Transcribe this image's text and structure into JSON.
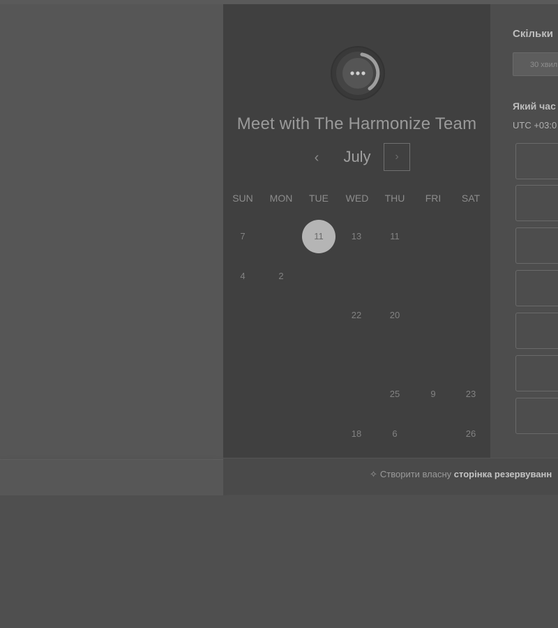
{
  "calendar": {
    "title": "Meet with The Harmonize Team",
    "month": "July",
    "prev_label": "‹",
    "next_label": "›",
    "weekdays": [
      "SUN",
      "MON",
      "TUE",
      "WED",
      "THU",
      "FRI",
      "SAT"
    ],
    "selected_day": "11",
    "days": [
      {
        "label": "7",
        "col": 0,
        "row": 0
      },
      {
        "label": "11",
        "col": 2,
        "row": 0,
        "selected": true
      },
      {
        "label": "13",
        "col": 3,
        "row": 0
      },
      {
        "label": "11",
        "col": 4,
        "row": 0
      },
      {
        "label": "4",
        "col": 0,
        "row": 1
      },
      {
        "label": "2",
        "col": 1,
        "row": 1
      },
      {
        "label": "22",
        "col": 3,
        "row": 2
      },
      {
        "label": "20",
        "col": 4,
        "row": 2
      },
      {
        "label": "25",
        "col": 4,
        "row": 4
      },
      {
        "label": "9",
        "col": 5,
        "row": 4
      },
      {
        "label": "23",
        "col": 6,
        "row": 4
      },
      {
        "label": "18",
        "col": 3,
        "row": 5
      },
      {
        "label": "6",
        "col": 4,
        "row": 5
      },
      {
        "label": "26",
        "col": 6,
        "row": 5
      }
    ]
  },
  "booking": {
    "duration_question": "Скільки",
    "duration_value": "30 хвил",
    "time_question": "Який час",
    "timezone": "UTC +03:0",
    "slot_count": 7
  },
  "footer": {
    "text": "Створити власну",
    "link": "сторінка резервуванн"
  },
  "colors": {
    "overlay": "#4f4f4f",
    "calendar_bg": "#404040",
    "selected_day": "#b5b5b5"
  }
}
